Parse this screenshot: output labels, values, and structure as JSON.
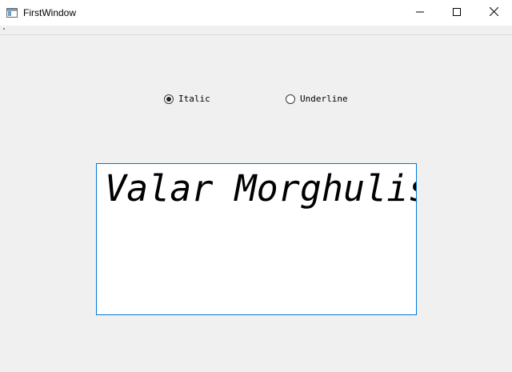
{
  "window": {
    "title": "FirstWindow",
    "icon": "app-window-icon",
    "controls": [
      "minimize-icon",
      "maximize-icon",
      "close-icon"
    ]
  },
  "options": {
    "italic": {
      "label": "Italic",
      "checked": true
    },
    "underline": {
      "label": "Underline",
      "checked": false
    }
  },
  "editor": {
    "text": "Valar Morghulis",
    "border_color": "#0078d7"
  }
}
